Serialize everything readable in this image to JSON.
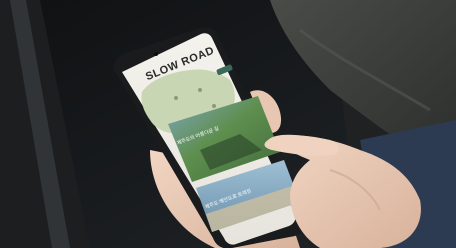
{
  "photo": {
    "colors": {
      "background": "#151719",
      "car_interior": "#2b2e31",
      "sweater": "#3d3f3c",
      "skin": "#e9cbb6",
      "phone_frame": "#1a1b1d",
      "screen_top": "#f1efe9",
      "map_green": "#c9d6b3",
      "banner_red": "#d8423a"
    },
    "screen": {
      "title": "SLOW ROAD",
      "card_caption_1": "제주도의 아름다운 길",
      "card_caption_2": "제주도 해안도로 트레킹"
    }
  }
}
